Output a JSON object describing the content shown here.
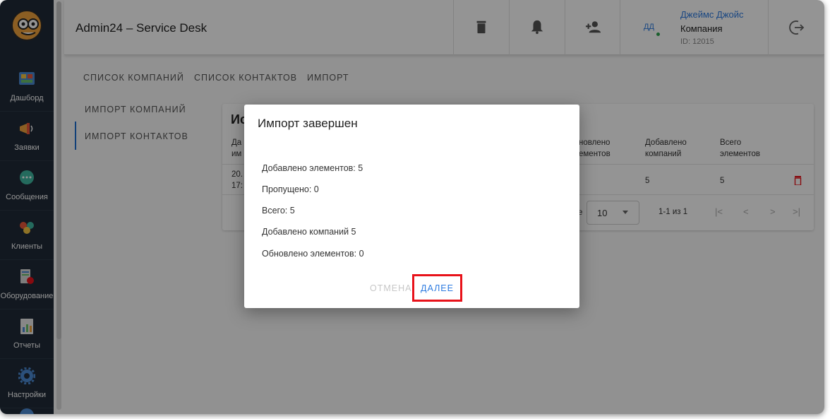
{
  "header": {
    "app_title": "Admin24 – Service Desk",
    "user_initials": "ДД",
    "user_name": "Джеймс Джойс",
    "user_company": "Компания",
    "user_id": "ID: 12015"
  },
  "sidebar": {
    "items": [
      {
        "label": "Дашборд",
        "icon": "dashboard-icon"
      },
      {
        "label": "Заявки",
        "icon": "megaphone-icon"
      },
      {
        "label": "Сообщения",
        "icon": "chat-icon"
      },
      {
        "label": "Клиенты",
        "icon": "clients-icon"
      },
      {
        "label": "Оборудование",
        "icon": "equipment-icon"
      },
      {
        "label": "Отчеты",
        "icon": "reports-icon"
      },
      {
        "label": "Настройки",
        "icon": "gear-icon"
      }
    ]
  },
  "tabs": [
    "СПИСОК КОМПАНИЙ",
    "СПИСОК КОНТАКТОВ",
    "ИМПОРТ"
  ],
  "subnav": [
    "ИМПОРТ КОМПАНИЙ",
    "ИМПОРТ КОНТАКТОВ"
  ],
  "card": {
    "title": "Ис",
    "headers": [
      "Да\nим",
      "новлено\nементов",
      "Добавлено\nкомпаний",
      "Всего\nэлементов"
    ],
    "row": {
      "date": "20.\n17:",
      "added_companies": "5",
      "total": "5"
    },
    "pager": {
      "rows_label": "е",
      "rows_per_page": "10",
      "count": "1-1 из 1"
    }
  },
  "dialog": {
    "title": "Импорт завершен",
    "lines": [
      "Добавлено элементов: 5",
      "Пропущено: 0",
      "Всего: 5",
      "Добавлено компаний 5",
      "Обновлено элементов: 0"
    ],
    "cancel_label": "ОТМЕНА",
    "next_label": "ДАЛЕЕ"
  },
  "colors": {
    "accent": "#2d7be0",
    "sidebar_bg": "#1f2a38",
    "highlight": "#e8121a"
  }
}
